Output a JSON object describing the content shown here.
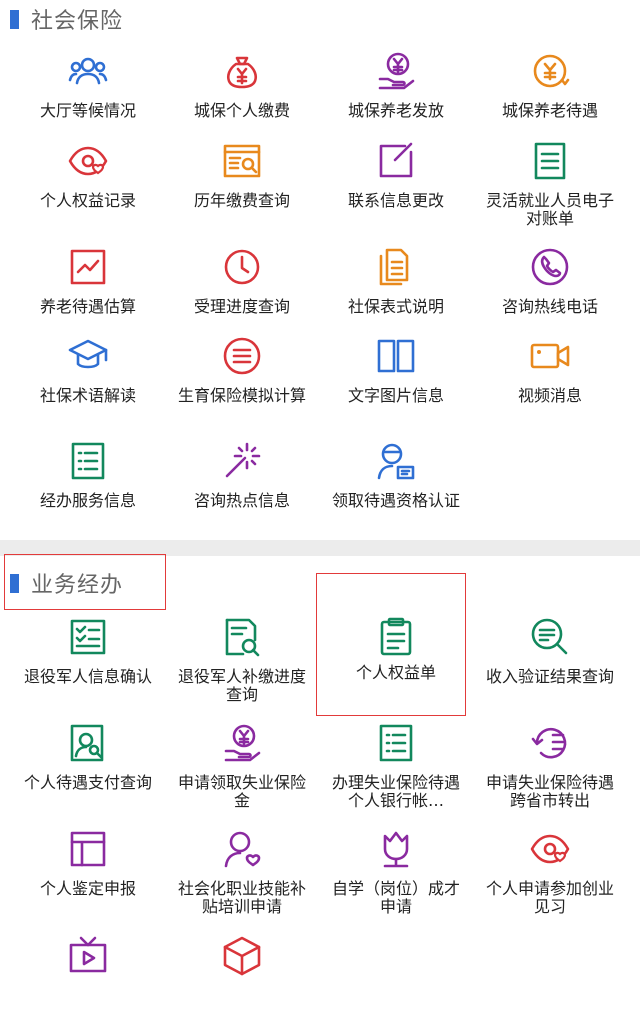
{
  "sections": {
    "social": {
      "title": "社会保险",
      "items": [
        {
          "label": "大厅等候情况",
          "icon": "users-icon"
        },
        {
          "label": "城保个人缴费",
          "icon": "money-bag-icon"
        },
        {
          "label": "城保养老发放",
          "icon": "yuan-hand-icon"
        },
        {
          "label": "城保养老待遇",
          "icon": "yuan-refresh-icon"
        },
        {
          "label": "个人权益记录",
          "icon": "eye-heart-icon"
        },
        {
          "label": "历年缴费查询",
          "icon": "document-search-icon"
        },
        {
          "label": "联系信息更改",
          "icon": "edit-icon"
        },
        {
          "label": "灵活就业人员电子对账单",
          "icon": "document-lines-icon"
        },
        {
          "label": "养老待遇估算",
          "icon": "trend-chart-icon"
        },
        {
          "label": "受理进度查询",
          "icon": "clock-icon"
        },
        {
          "label": "社保表式说明",
          "icon": "file-stack-icon"
        },
        {
          "label": "咨询热线电话",
          "icon": "phone-icon"
        },
        {
          "label": "社保术语解读",
          "icon": "graduation-cap-icon"
        },
        {
          "label": "生育保险模拟计算",
          "icon": "list-circle-icon"
        },
        {
          "label": "文字图片信息",
          "icon": "book-icon"
        },
        {
          "label": "视频消息",
          "icon": "video-camera-icon"
        },
        {
          "label": "经办服务信息",
          "icon": "list-document-icon"
        },
        {
          "label": "咨询热点信息",
          "icon": "magic-wand-icon"
        },
        {
          "label": "领取待遇资格认证",
          "icon": "user-verify-icon"
        }
      ]
    },
    "business": {
      "title": "业务经办",
      "items": [
        {
          "label": "退役军人信息确认",
          "icon": "checklist-icon"
        },
        {
          "label": "退役军人补缴进度查询",
          "icon": "document-magnifier-icon"
        },
        {
          "label": "个人权益单",
          "icon": "clipboard-icon"
        },
        {
          "label": "收入验证结果查询",
          "icon": "magnifier-lines-icon"
        },
        {
          "label": "个人待遇支付查询",
          "icon": "person-search-icon"
        },
        {
          "label": "申请领取失业保险金",
          "icon": "yuan-hand-icon"
        },
        {
          "label": "办理失业保险待遇个人银行帐…",
          "icon": "list-document-icon"
        },
        {
          "label": "申请失业保险待遇跨省市转出",
          "icon": "history-icon"
        },
        {
          "label": "个人鉴定申报",
          "icon": "layout-icon"
        },
        {
          "label": "社会化职业技能补贴培训申请",
          "icon": "user-heart-icon"
        },
        {
          "label": "自学（岗位）成才申请",
          "icon": "tulip-icon"
        },
        {
          "label": "个人申请参加创业见习",
          "icon": "eye-heart-icon"
        },
        {
          "label": "",
          "icon": "tv-play-icon"
        },
        {
          "label": "",
          "icon": "cube-icon"
        }
      ]
    }
  },
  "colors": {
    "blue": "#2f6fd3",
    "red": "#d9353a",
    "orange": "#e8891d",
    "purple": "#8a2aa0",
    "green": "#12885d",
    "highlight": "#e23a3a"
  }
}
